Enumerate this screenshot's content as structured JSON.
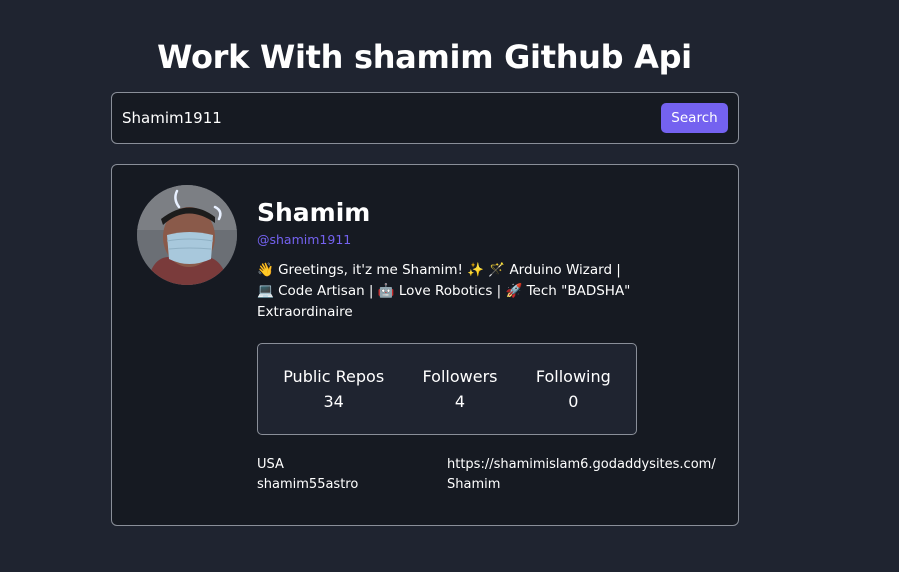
{
  "header": {
    "title": "Work With shamim Github Api"
  },
  "search": {
    "value": "Shamim1911",
    "button_label": "Search"
  },
  "profile": {
    "name": "Shamim",
    "login": "@shamim1911",
    "bio_line1": "👋 Greetings, it'z me Shamim! ✨ 🪄 Arduino Wizard |",
    "bio_line2": "💻 Code Artisan | 🤖 Love Robotics | 🚀 Tech \"BADSHA\"",
    "bio_line3": "Extraordinaire",
    "stats": [
      {
        "label": "Public Repos",
        "value": "34"
      },
      {
        "label": "Followers",
        "value": "4"
      },
      {
        "label": "Following",
        "value": "0"
      }
    ],
    "location": "USA",
    "twitter": "shamim55astro",
    "blog": "https://shamimislam6.godaddysites.com/",
    "company": "Shamim"
  },
  "colors": {
    "page_bg": "#1f2430",
    "card_bg": "#161a22",
    "accent": "#7462f0",
    "border": "#8a8f99"
  }
}
